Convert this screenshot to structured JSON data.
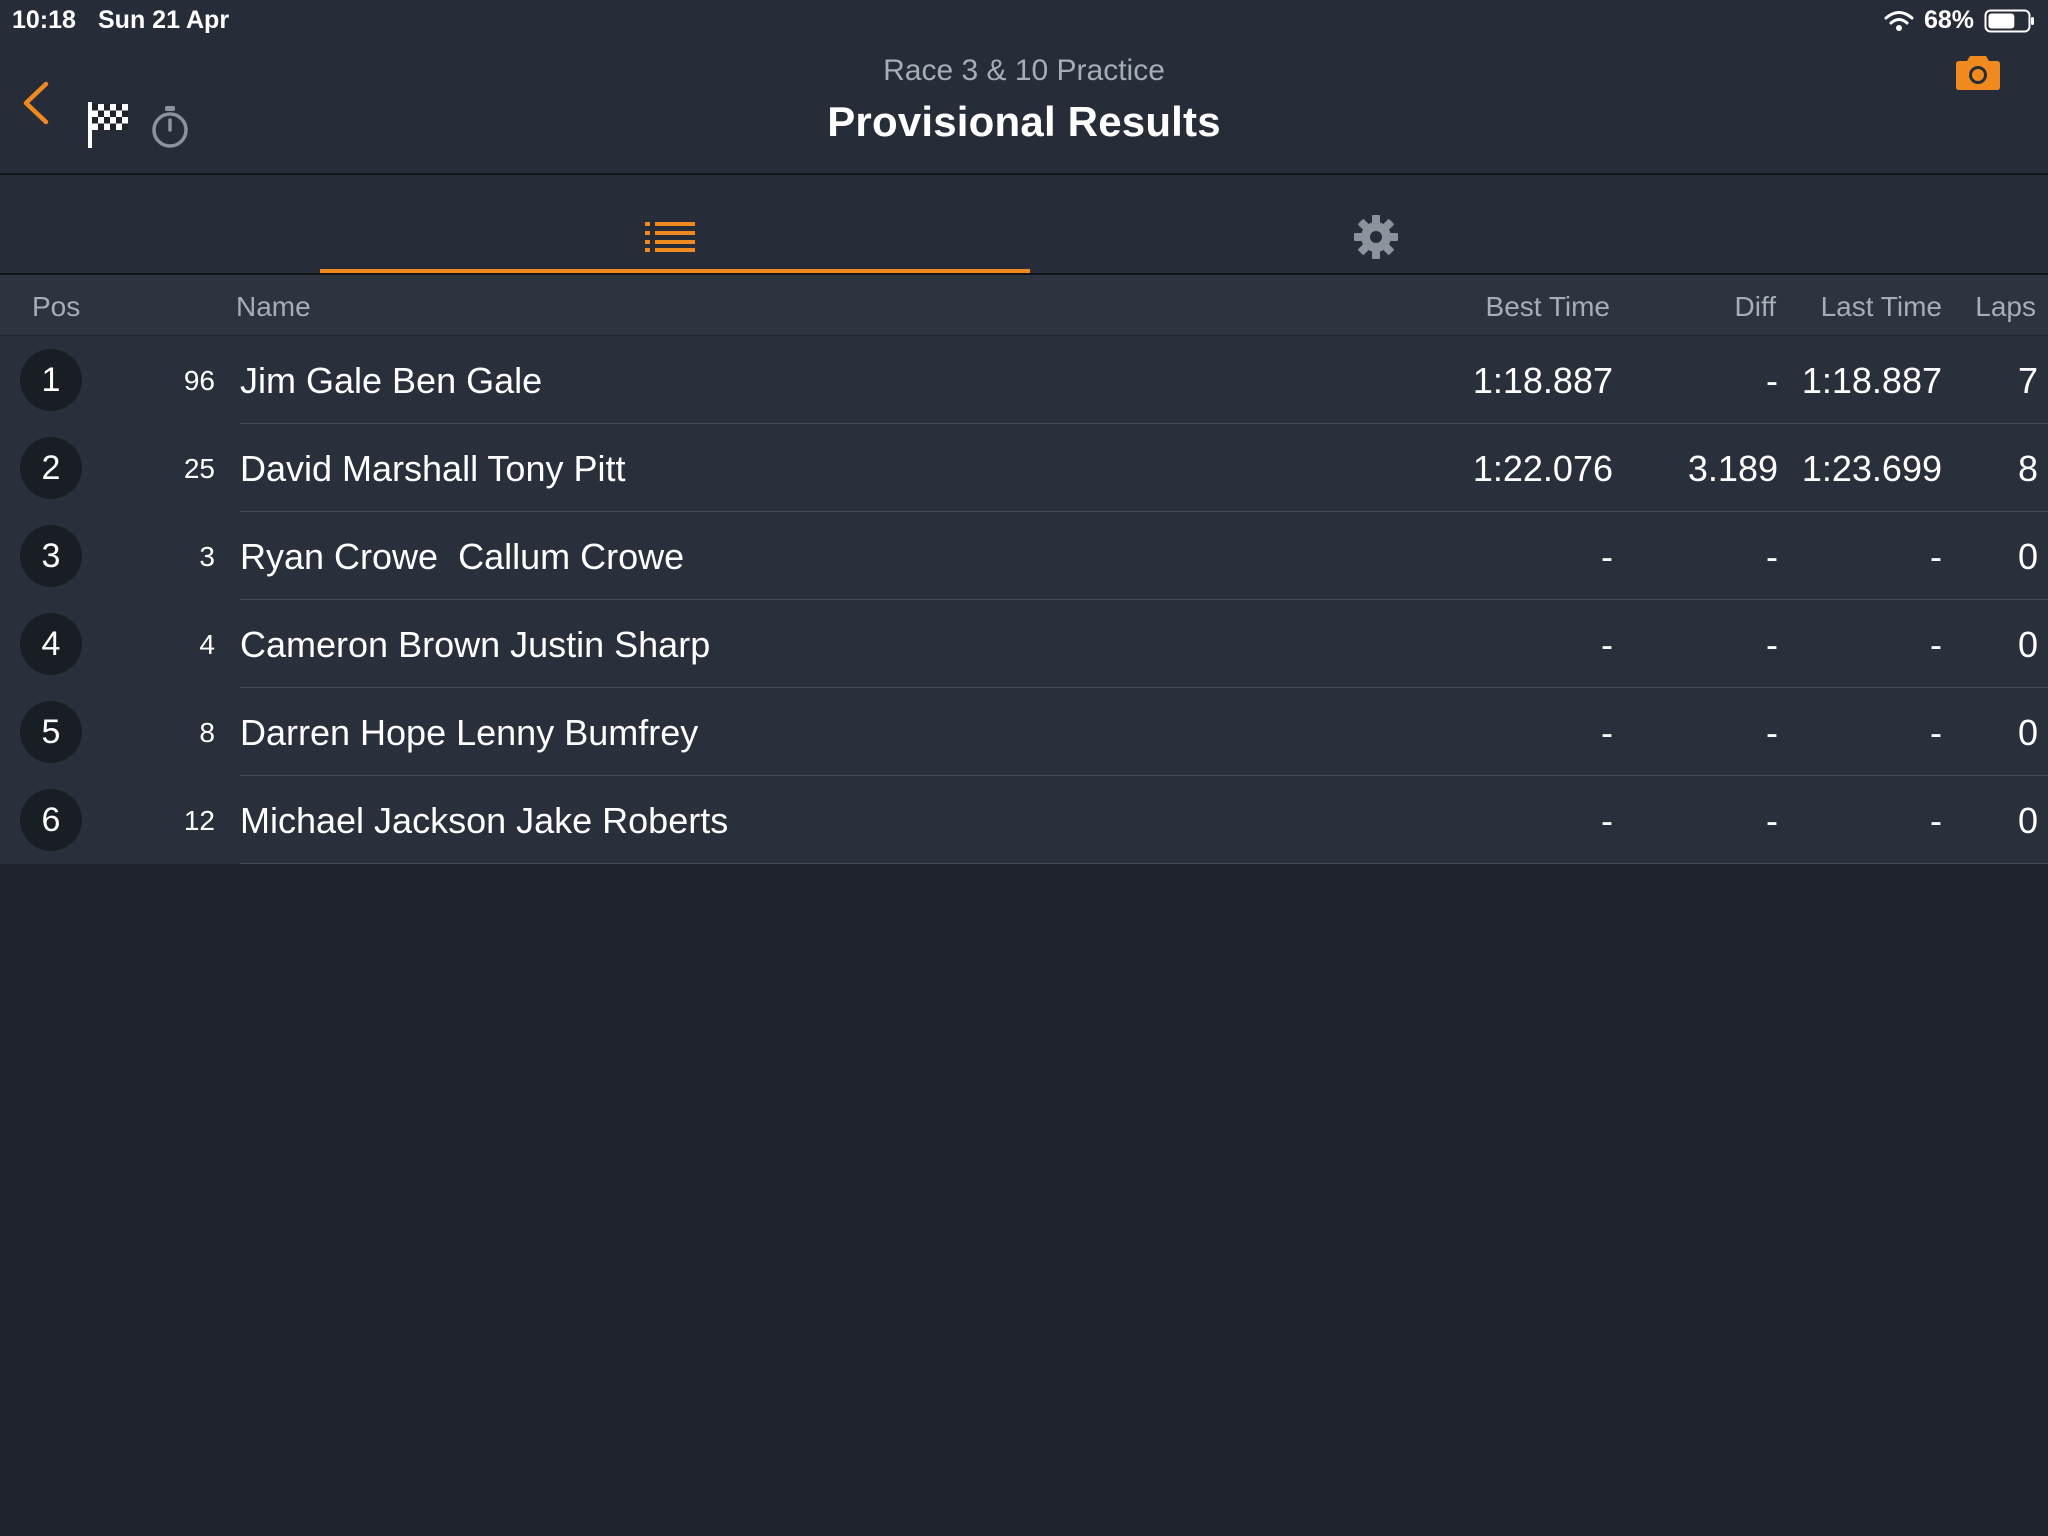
{
  "status_bar": {
    "time": "10:18",
    "date": "Sun 21 Apr",
    "battery": "68%",
    "battery_level": 0.68
  },
  "header": {
    "subtitle": "Race 3 & 10 Practice",
    "title": "Provisional Results",
    "accent_color": "#f08a1e",
    "icons": [
      "back-chevron-icon",
      "checkered-flag-icon",
      "stopwatch-icon",
      "camera-icon"
    ]
  },
  "tabs": [
    {
      "icon": "list-icon",
      "selected": true
    },
    {
      "icon": "gear-icon",
      "selected": false
    }
  ],
  "table": {
    "columns": {
      "pos": "Pos",
      "name": "Name",
      "best": "Best Time",
      "diff": "Diff",
      "last": "Last Time",
      "laps": "Laps"
    },
    "rows": [
      {
        "pos": "1",
        "num": "96",
        "name": "Jim Gale Ben Gale",
        "best": "1:18.887",
        "diff": "-",
        "last": "1:18.887",
        "laps": "7"
      },
      {
        "pos": "2",
        "num": "25",
        "name": "David Marshall Tony Pitt",
        "best": "1:22.076",
        "diff": "3.189",
        "last": "1:23.699",
        "laps": "8"
      },
      {
        "pos": "3",
        "num": "3",
        "name": "Ryan Crowe  Callum Crowe",
        "best": "-",
        "diff": "-",
        "last": "-",
        "laps": "0"
      },
      {
        "pos": "4",
        "num": "4",
        "name": "Cameron Brown Justin Sharp",
        "best": "-",
        "diff": "-",
        "last": "-",
        "laps": "0"
      },
      {
        "pos": "5",
        "num": "8",
        "name": "Darren Hope Lenny Bumfrey",
        "best": "-",
        "diff": "-",
        "last": "-",
        "laps": "0"
      },
      {
        "pos": "6",
        "num": "12",
        "name": "Michael Jackson Jake Roberts",
        "best": "-",
        "diff": "-",
        "last": "-",
        "laps": "0"
      }
    ]
  }
}
